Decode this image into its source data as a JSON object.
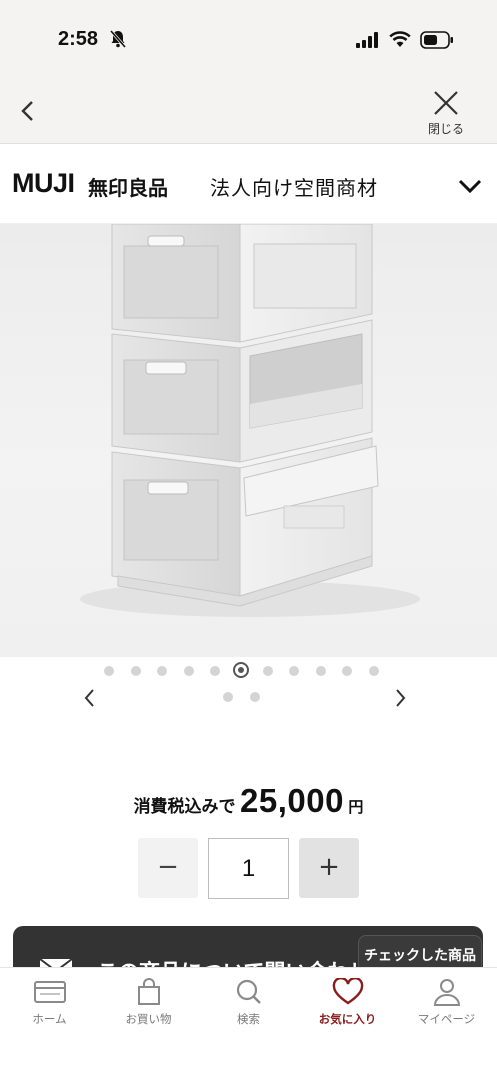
{
  "status": {
    "time": "2:58"
  },
  "nav": {
    "close_label": "閉じる"
  },
  "brand": {
    "logo": "MUJI",
    "name_jp": "無印良品",
    "subtitle": "法人向け空間商材"
  },
  "carousel": {
    "dot_count": 12,
    "active_index": 5,
    "second_row_dots": 2
  },
  "price": {
    "label": "消費税込みで",
    "value": "25,000",
    "unit": "円"
  },
  "quantity": {
    "minus_label": "−",
    "value": "1",
    "plus_label": "+"
  },
  "inquiry": {
    "text": "この商品について問い合わせる",
    "recent_label": "チェックした商品"
  },
  "tabs": [
    {
      "label": "ホーム",
      "icon": "home-card-icon"
    },
    {
      "label": "お買い物",
      "icon": "shopping-bag-icon"
    },
    {
      "label": "検索",
      "icon": "search-icon"
    },
    {
      "label": "お気に入り",
      "icon": "heart-icon",
      "active": true
    },
    {
      "label": "マイページ",
      "icon": "person-icon"
    }
  ],
  "colors": {
    "accent": "#8a1c1c",
    "banner": "#333333",
    "status_bg": "#f4f3f1"
  }
}
